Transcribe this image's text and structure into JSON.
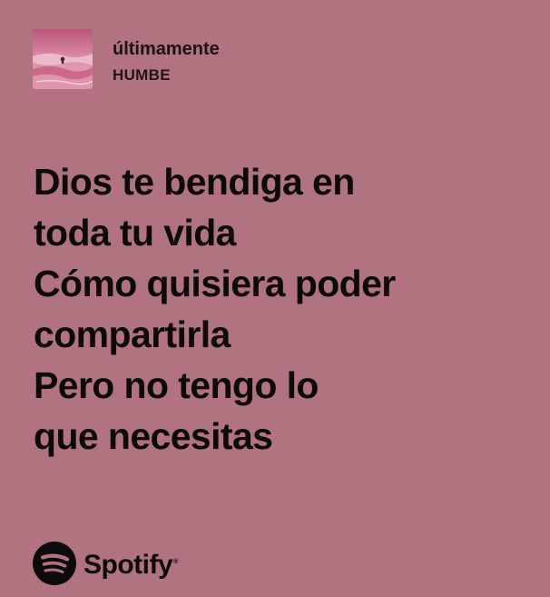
{
  "card": {
    "background_color": "#b27380",
    "text_color": "#0d0a0b"
  },
  "track": {
    "cover_icon": "album-cover-image",
    "title": "últimamente",
    "artist": "HUMBE"
  },
  "lyrics": {
    "lines": [
      "Dios te bendiga en",
      "toda tu vida",
      "Cómo quisiera poder",
      "compartirla",
      "Pero no tengo lo",
      "que necesitas"
    ]
  },
  "branding": {
    "icon": "spotify-logo-icon",
    "name": "Spotify",
    "trademark": "®"
  }
}
